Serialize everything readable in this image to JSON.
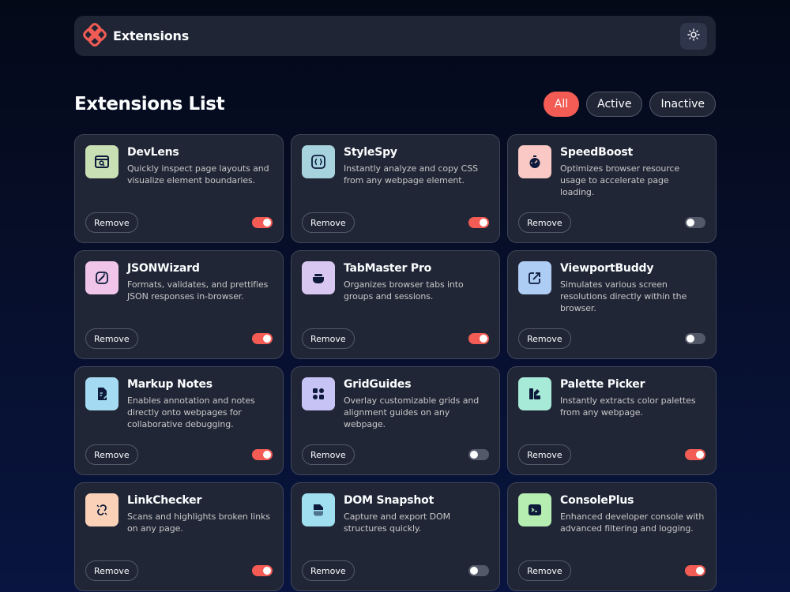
{
  "header": {
    "title": "Extensions",
    "logo_icon": "extensions-logo",
    "theme_icon": "sun-icon"
  },
  "list": {
    "title": "Extensions List",
    "filters": [
      {
        "label": "All",
        "active": true
      },
      {
        "label": "Active",
        "active": false
      },
      {
        "label": "Inactive",
        "active": false
      }
    ]
  },
  "remove_label": "Remove",
  "extensions": [
    {
      "name": "DevLens",
      "desc": "Quickly inspect page layouts and visualize element boundaries.",
      "enabled": true,
      "icon": "browser-search-icon",
      "icon_bg": "#c9dfb4"
    },
    {
      "name": "StyleSpy",
      "desc": "Instantly analyze and copy CSS from any webpage element.",
      "enabled": true,
      "icon": "css-braces-icon",
      "icon_bg": "#a7d3de"
    },
    {
      "name": "SpeedBoost",
      "desc": "Optimizes browser resource usage to accelerate page loading.",
      "enabled": false,
      "icon": "stopwatch-icon",
      "icon_bg": "#fbc9c5"
    },
    {
      "name": "JSONWizard",
      "desc": "Formats, validates, and prettifies JSON responses in-browser.",
      "enabled": true,
      "icon": "magic-wand-icon",
      "icon_bg": "#f0c5e9"
    },
    {
      "name": "TabMaster Pro",
      "desc": "Organizes browser tabs into groups and sessions.",
      "enabled": true,
      "icon": "tabs-icon",
      "icon_bg": "#d8c7f1"
    },
    {
      "name": "ViewportBuddy",
      "desc": "Simulates various screen resolutions directly within the browser.",
      "enabled": false,
      "icon": "resize-icon",
      "icon_bg": "#aecdf5"
    },
    {
      "name": "Markup Notes",
      "desc": "Enables annotation and notes directly onto webpages for collaborative debugging.",
      "enabled": true,
      "icon": "notes-icon",
      "icon_bg": "#a5dbf2"
    },
    {
      "name": "GridGuides",
      "desc": "Overlay customizable grids and alignment guides on any webpage.",
      "enabled": false,
      "icon": "grid-icon",
      "icon_bg": "#c7c3f5"
    },
    {
      "name": "Palette Picker",
      "desc": "Instantly extracts color palettes from any webpage.",
      "enabled": true,
      "icon": "palette-icon",
      "icon_bg": "#a6ead7"
    },
    {
      "name": "LinkChecker",
      "desc": "Scans and highlights broken links on any page.",
      "enabled": true,
      "icon": "broken-link-icon",
      "icon_bg": "#fbd2b8"
    },
    {
      "name": "DOM Snapshot",
      "desc": "Capture and export DOM structures quickly.",
      "enabled": false,
      "icon": "snapshot-icon",
      "icon_bg": "#9fdff0"
    },
    {
      "name": "ConsolePlus",
      "desc": "Enhanced developer console with advanced filtering and logging.",
      "enabled": true,
      "icon": "terminal-icon",
      "icon_bg": "#b5eeb0"
    }
  ],
  "colors": {
    "accent": "#f25c54",
    "card": "#212636",
    "icon_fg": "#0d1a3b"
  }
}
